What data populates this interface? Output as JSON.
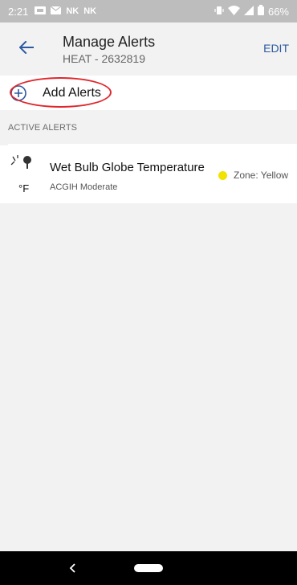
{
  "status_bar": {
    "time": "2:21",
    "icons": [
      "sim-icon",
      "NK",
      "NK"
    ],
    "battery": "66%"
  },
  "header": {
    "title": "Manage Alerts",
    "subtitle": "HEAT - 2632819",
    "edit_label": "EDIT"
  },
  "add_alerts": {
    "label": "Add Alerts"
  },
  "section": {
    "title": "ACTIVE ALERTS"
  },
  "alerts": [
    {
      "name": "Wet Bulb Globe Temperature",
      "standard": "ACGIH Moderate",
      "unit": "°F",
      "zone_label": "Zone: Yellow",
      "zone_color": "#f2e200"
    }
  ],
  "colors": {
    "accent": "#2c5aa0",
    "highlight": "#e0262c",
    "background": "#f2f2f2"
  }
}
